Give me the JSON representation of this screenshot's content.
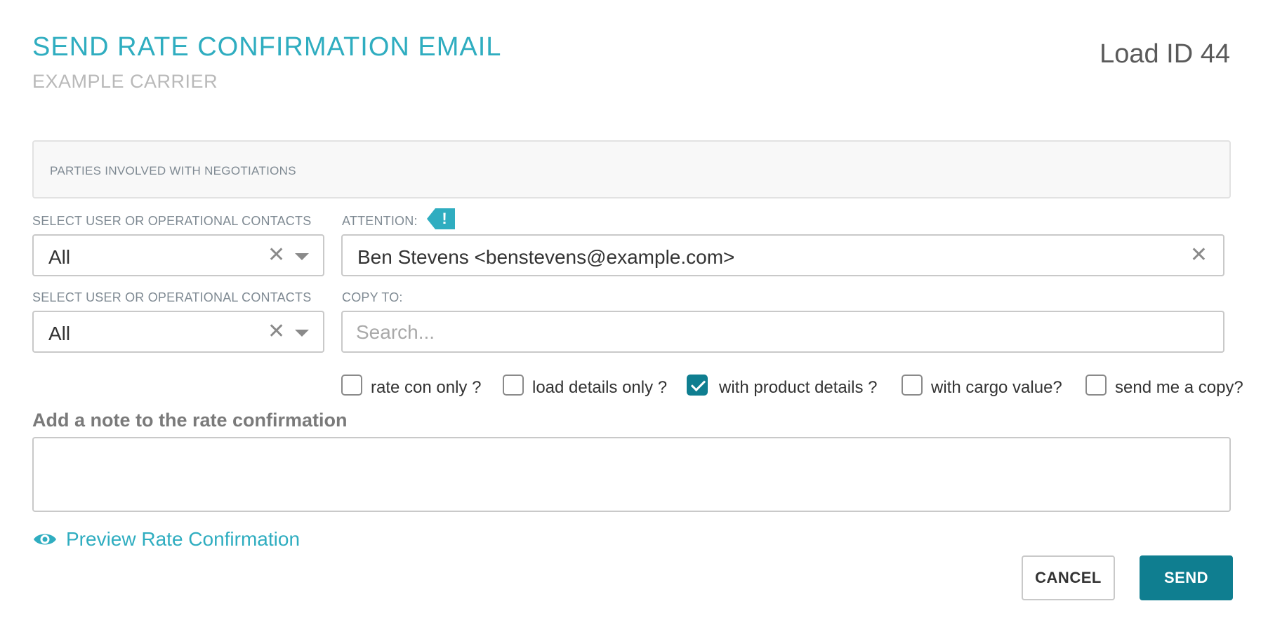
{
  "header": {
    "title": "SEND RATE CONFIRMATION EMAIL",
    "subtitle": "EXAMPLE CARRIER",
    "load_id": "Load ID 44"
  },
  "parties_panel": {
    "label": "PARTIES INVOLVED WITH NEGOTIATIONS"
  },
  "attention_row": {
    "contacts_label": "SELECT USER OR OPERATIONAL CONTACTS",
    "contacts_value": "All",
    "attention_label": "ATTENTION:",
    "alert_icon_text": "!",
    "attention_value": "Ben Stevens <benstevens@example.com>"
  },
  "copy_row": {
    "contacts_label": "SELECT USER OR OPERATIONAL CONTACTS",
    "contacts_value": "All",
    "copy_label": "COPY TO:",
    "copy_placeholder": "Search..."
  },
  "options": [
    {
      "label": "rate con only ?",
      "checked": false
    },
    {
      "label": "load details only ?",
      "checked": false
    },
    {
      "label": "with product details ?",
      "checked": true
    },
    {
      "label": "with cargo value?",
      "checked": false
    },
    {
      "label": "send me a copy?",
      "checked": false
    }
  ],
  "note": {
    "heading": "Add a note to the rate confirmation",
    "value": ""
  },
  "preview": {
    "label": "Preview Rate Confirmation",
    "icon": "eye-icon"
  },
  "actions": {
    "cancel_label": "CANCEL",
    "send_label": "SEND"
  },
  "colors": {
    "accent": "#2fadc0",
    "primary_button": "#0f7e90",
    "muted_label": "#7f8a93"
  }
}
